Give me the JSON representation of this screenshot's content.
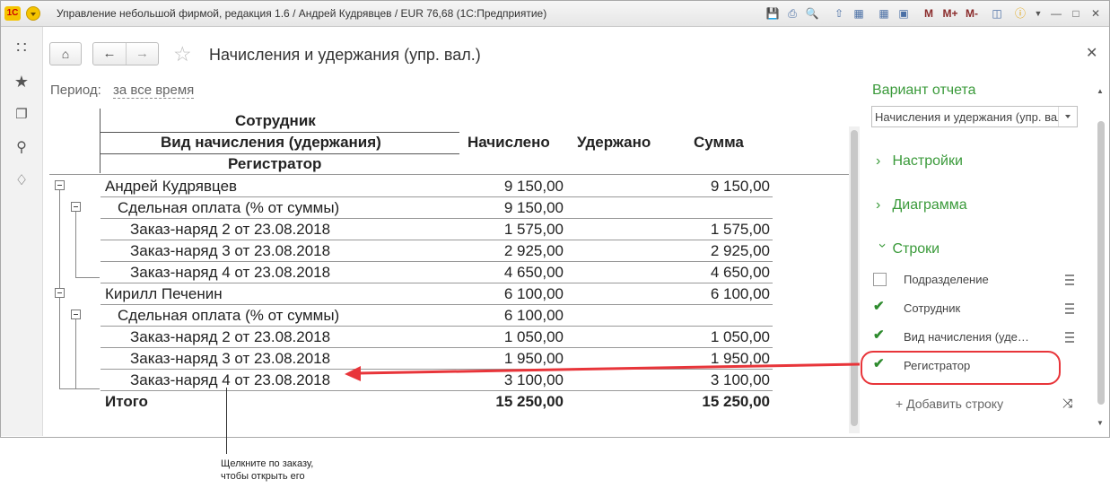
{
  "window": {
    "title": "Управление небольшой фирмой, редакция 1.6 / Андрей Кудрявцев / EUR 76,68  (1С:Предприятие)",
    "logo_text": "1С",
    "toolbar_icons": [
      "save-icon",
      "print-icon",
      "print-preview-icon",
      "upload-icon",
      "download-icon",
      "calculator-icon",
      "calendar-icon",
      "m-icon",
      "m-plus-icon",
      "m-minus-icon",
      "panel-icon",
      "info-icon",
      "menu-icon",
      "minimize-icon",
      "maximize-icon",
      "close-icon"
    ],
    "toolbar_m": "M",
    "toolbar_mplus": "M+",
    "toolbar_mminus": "M-"
  },
  "sidebar": {
    "icons": [
      "apps-grid-icon",
      "favorites-star-icon",
      "history-icon",
      "search-icon",
      "notifications-bell-icon"
    ]
  },
  "form": {
    "title": "Начисления и удержания (упр. вал.)",
    "period_label": "Период:",
    "period_value": "за все время"
  },
  "report": {
    "headers": {
      "employee": "Сотрудник",
      "accrual_type": "Вид начисления (удержания)",
      "registrar": "Регистратор",
      "accrued": "Начислено",
      "withheld": "Удержано",
      "sum": "Сумма"
    },
    "rows": [
      {
        "level": 0,
        "name": "Андрей Кудрявцев",
        "accrued": "9 150,00",
        "withheld": "",
        "sum": "9 150,00"
      },
      {
        "level": 1,
        "name": "Сдельная оплата (% от суммы)",
        "accrued": "9 150,00",
        "withheld": "",
        "sum": ""
      },
      {
        "level": 2,
        "name": "Заказ-наряд 2 от 23.08.2018",
        "accrued": "1 575,00",
        "withheld": "",
        "sum": "1 575,00"
      },
      {
        "level": 2,
        "name": "Заказ-наряд 3 от 23.08.2018",
        "accrued": "2 925,00",
        "withheld": "",
        "sum": "2 925,00"
      },
      {
        "level": 2,
        "name": "Заказ-наряд 4 от 23.08.2018",
        "accrued": "4 650,00",
        "withheld": "",
        "sum": "4 650,00"
      },
      {
        "level": 0,
        "name": "Кирилл Печенин",
        "accrued": "6 100,00",
        "withheld": "",
        "sum": "6 100,00"
      },
      {
        "level": 1,
        "name": "Сдельная оплата (% от суммы)",
        "accrued": "6 100,00",
        "withheld": "",
        "sum": ""
      },
      {
        "level": 2,
        "name": "Заказ-наряд 2 от 23.08.2018",
        "accrued": "1 050,00",
        "withheld": "",
        "sum": "1 050,00"
      },
      {
        "level": 2,
        "name": "Заказ-наряд 3 от 23.08.2018",
        "accrued": "1 950,00",
        "withheld": "",
        "sum": "1 950,00"
      },
      {
        "level": 2,
        "name": "Заказ-наряд 4 от 23.08.2018",
        "accrued": "3 100,00",
        "withheld": "",
        "sum": "3 100,00"
      }
    ],
    "total": {
      "name": "Итого",
      "accrued": "15 250,00",
      "withheld": "",
      "sum": "15 250,00"
    }
  },
  "settings": {
    "title": "Вариант отчета",
    "variant_value": "Начисления и удержания (упр. вал.)",
    "sections": {
      "settings": "Настройки",
      "chart": "Диаграмма",
      "rows": "Строки"
    },
    "fields": [
      {
        "label": "Подразделение",
        "checked": false
      },
      {
        "label": "Сотрудник",
        "checked": true
      },
      {
        "label": "Вид начисления (уде…",
        "checked": true
      },
      {
        "label": "Регистратор",
        "checked": true
      }
    ],
    "add_row": "+ Добавить строку"
  },
  "annotation": {
    "line1": "Щелкните по заказу,",
    "line2": "чтобы открыть его",
    "highlight_color": "#e8353a",
    "accent_color": "#3a9a3a"
  }
}
